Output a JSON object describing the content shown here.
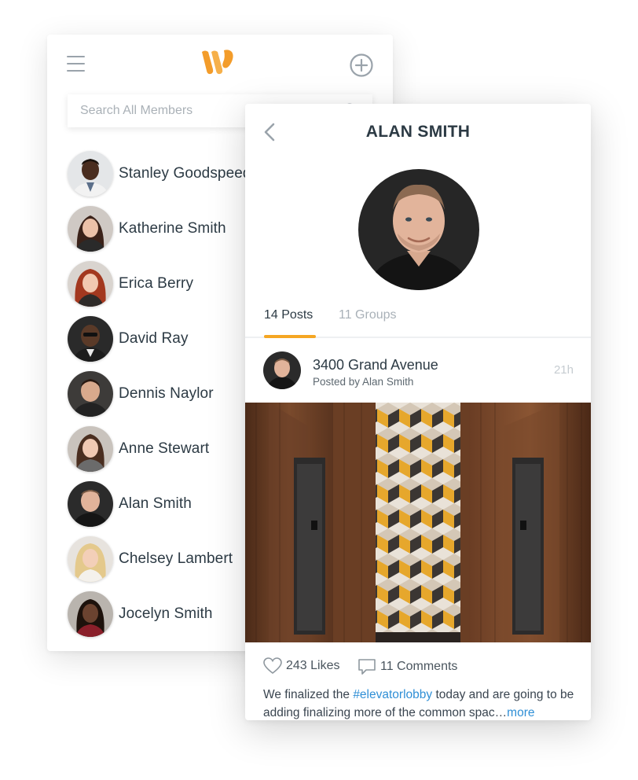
{
  "members_screen": {
    "search": {
      "placeholder": "Search All Members",
      "value": ""
    },
    "icons": {
      "menu": "hamburger-menu-icon",
      "logo": "w-logo",
      "add": "add-circle-icon",
      "search": "search-icon"
    },
    "members": [
      {
        "name": "Stanley Goodspeed",
        "avatar": "stanley"
      },
      {
        "name": "Katherine Smith",
        "avatar": "katherine"
      },
      {
        "name": "Erica Berry",
        "avatar": "erica"
      },
      {
        "name": "David Ray",
        "avatar": "david"
      },
      {
        "name": "Dennis Naylor",
        "avatar": "dennis"
      },
      {
        "name": "Anne Stewart",
        "avatar": "anne"
      },
      {
        "name": "Alan Smith",
        "avatar": "alan"
      },
      {
        "name": "Chelsey Lambert",
        "avatar": "chelsey"
      },
      {
        "name": "Jocelyn Smith",
        "avatar": "jocelyn"
      }
    ]
  },
  "profile_screen": {
    "title": "ALAN SMITH",
    "tabs": [
      {
        "label": "14 Posts",
        "active": true
      },
      {
        "label": "11 Groups",
        "active": false
      }
    ],
    "post": {
      "title": "3400 Grand Avenue",
      "posted_by": "Posted by Alan Smith",
      "time": "21h",
      "likes": "243 Likes",
      "comments": "11 Comments",
      "caption_before": "We finalized the ",
      "hashtag": "#elevatorlobby",
      "caption_after": " today and are going to be adding finalizing more of the common spac…",
      "more": "more"
    }
  },
  "colors": {
    "accent": "#f5a623",
    "logo": "#f39c2a",
    "link": "#2f8fd6",
    "text": "#2c3a44",
    "muted": "#a9b1b8"
  }
}
